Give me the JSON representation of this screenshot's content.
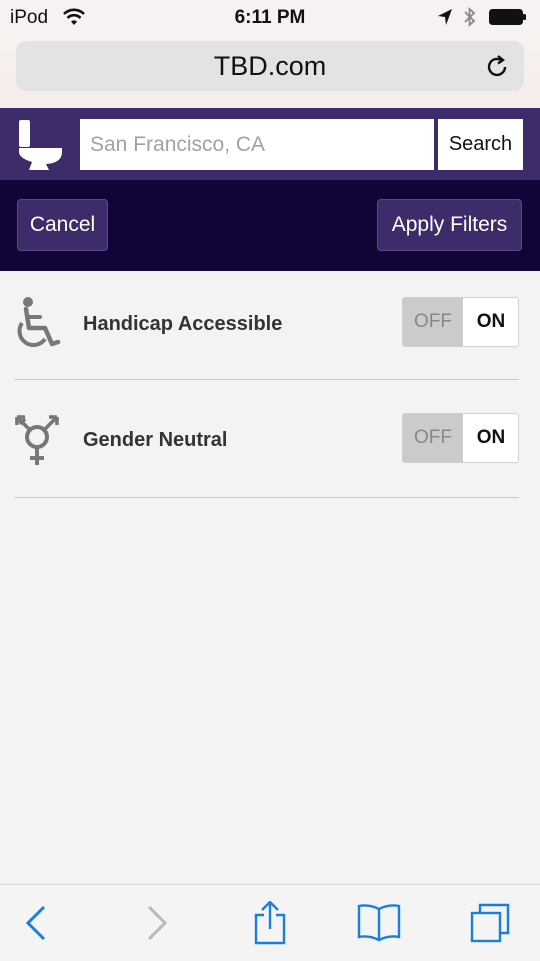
{
  "status_bar": {
    "carrier": "iPod",
    "time": "6:11 PM"
  },
  "browser": {
    "url": "TBD.com"
  },
  "header": {
    "logo_icon": "toilet-icon",
    "search_placeholder": "San Francisco, CA",
    "search_button": "Search"
  },
  "filter_bar": {
    "cancel_label": "Cancel",
    "apply_label": "Apply Filters"
  },
  "filters": [
    {
      "icon": "wheelchair-icon",
      "label": "Handicap Accessible",
      "off_label": "OFF",
      "on_label": "ON"
    },
    {
      "icon": "transgender-icon",
      "label": "Gender Neutral",
      "off_label": "OFF",
      "on_label": "ON"
    }
  ],
  "colors": {
    "header": "#3e2c6a",
    "filter_bar": "#110538",
    "toolbar_accent": "#1a7ee0"
  },
  "toolbar": {
    "icons": [
      "back-icon",
      "forward-icon",
      "share-icon",
      "bookmarks-icon",
      "tabs-icon"
    ]
  }
}
